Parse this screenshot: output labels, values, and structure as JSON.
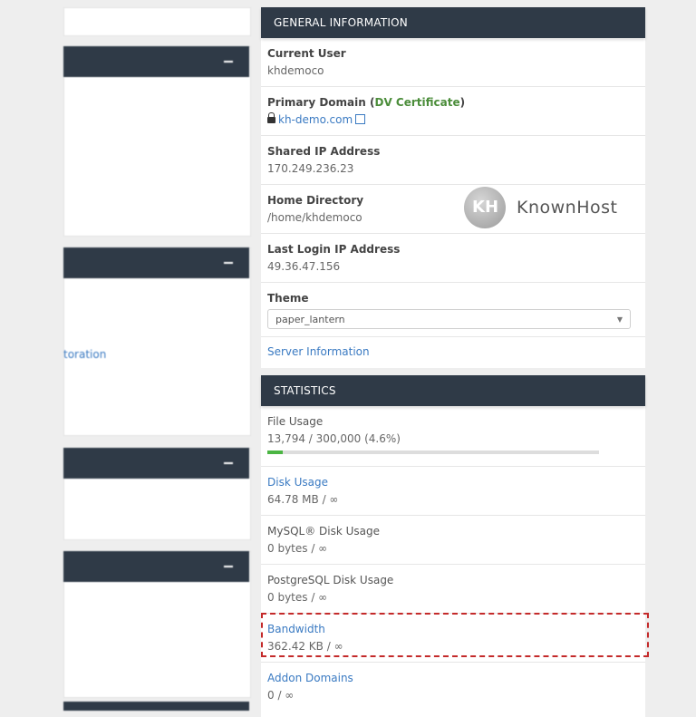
{
  "left": {
    "partial_link": "toration"
  },
  "general": {
    "header": "GENERAL INFORMATION",
    "current_user_label": "Current User",
    "current_user_value": "khdemoco",
    "primary_domain_label": "Primary Domain (",
    "dv_cert": "DV Certificate",
    "primary_domain_close": ")",
    "primary_domain_value": "kh-demo.com",
    "shared_ip_label": "Shared IP Address",
    "shared_ip_value": "170.249.236.23",
    "home_dir_label": "Home Directory",
    "home_dir_value": "/home/khdemoco",
    "last_login_label": "Last Login IP Address",
    "last_login_value": "49.36.47.156",
    "theme_label": "Theme",
    "theme_value": "paper_lantern",
    "server_info": "Server Information"
  },
  "statistics": {
    "header": "STATISTICS",
    "file_usage_label": "File Usage",
    "file_usage_value": "13,794 / 300,000   (4.6%)",
    "file_usage_fraction": 0.046,
    "disk_usage_label": "Disk Usage",
    "disk_usage_value": "64.78 MB / ∞",
    "mysql_label": "MySQL® Disk Usage",
    "mysql_value": "0 bytes / ∞",
    "postgres_label": "PostgreSQL Disk Usage",
    "postgres_value": "0 bytes / ∞",
    "bandwidth_label": "Bandwidth",
    "bandwidth_value": "362.42 KB / ∞",
    "addon_label": "Addon Domains",
    "addon_value": "0 / ∞"
  },
  "watermark": {
    "brand": "KnownHost",
    "mark": "KH"
  },
  "colors": {
    "header_bg": "#2f3a47",
    "link": "#3a7ac2",
    "highlight": "#c42a2a",
    "progress": "#4bb543"
  }
}
